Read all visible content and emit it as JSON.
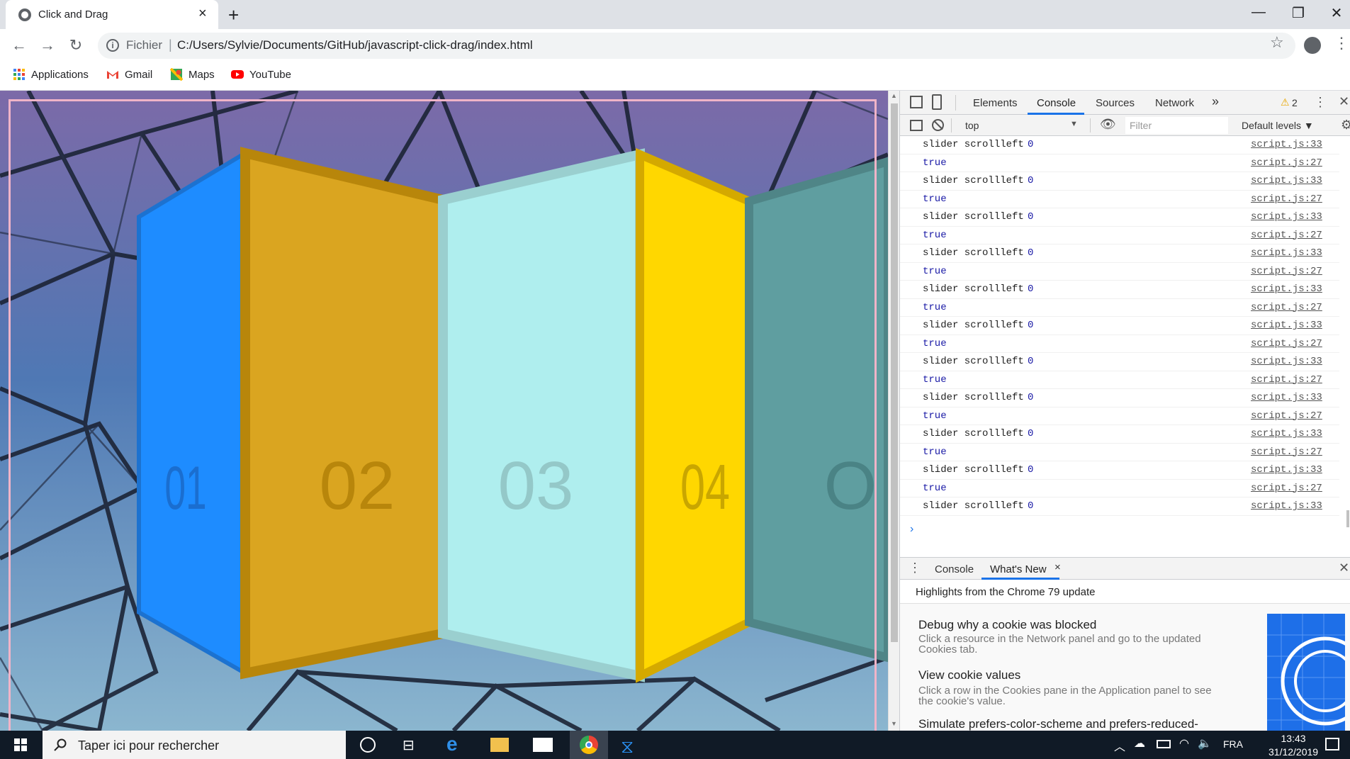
{
  "browser": {
    "tab_title": "Click and Drag",
    "tab_close": "×",
    "new_tab": "+",
    "window_minimize": "—",
    "window_restore": "❐",
    "window_close": "✕",
    "url_scheme": "Fichier",
    "url_separator": "|",
    "url": "C:/Users/Sylvie/Documents/GitHub/javascript-click-drag/index.html",
    "bookmarks": [
      {
        "label": "Applications",
        "icon": "apps-grid-icon"
      },
      {
        "label": "Gmail",
        "icon": "gmail-icon"
      },
      {
        "label": "Maps",
        "icon": "maps-icon"
      },
      {
        "label": "YouTube",
        "icon": "youtube-icon"
      }
    ]
  },
  "page": {
    "panels": [
      {
        "number": "01",
        "color": "#1e8cff"
      },
      {
        "number": "02",
        "color": "#daa520"
      },
      {
        "number": "03",
        "color": "#afeeee"
      },
      {
        "number": "04",
        "color": "#ffd700"
      },
      {
        "number": "O",
        "color": "#5f9ea0"
      }
    ]
  },
  "devtools": {
    "tabs": [
      "Elements",
      "Console",
      "Sources",
      "Network"
    ],
    "active_tab": "Console",
    "more_tabs": "»",
    "warning_count": "2",
    "context": "top",
    "filter_placeholder": "Filter",
    "levels": "Default levels ▼",
    "log_rows": [
      {
        "msg": "slider scrollleft",
        "num": "0",
        "src": "script.js:33"
      },
      {
        "msg": "true",
        "num": "",
        "src": "script.js:27"
      },
      {
        "msg": "slider scrollleft",
        "num": "0",
        "src": "script.js:33"
      },
      {
        "msg": "true",
        "num": "",
        "src": "script.js:27"
      },
      {
        "msg": "slider scrollleft",
        "num": "0",
        "src": "script.js:33"
      },
      {
        "msg": "true",
        "num": "",
        "src": "script.js:27"
      },
      {
        "msg": "slider scrollleft",
        "num": "0",
        "src": "script.js:33"
      },
      {
        "msg": "true",
        "num": "",
        "src": "script.js:27"
      },
      {
        "msg": "slider scrollleft",
        "num": "0",
        "src": "script.js:33"
      },
      {
        "msg": "true",
        "num": "",
        "src": "script.js:27"
      },
      {
        "msg": "slider scrollleft",
        "num": "0",
        "src": "script.js:33"
      },
      {
        "msg": "true",
        "num": "",
        "src": "script.js:27"
      },
      {
        "msg": "slider scrollleft",
        "num": "0",
        "src": "script.js:33"
      },
      {
        "msg": "true",
        "num": "",
        "src": "script.js:27"
      },
      {
        "msg": "slider scrollleft",
        "num": "0",
        "src": "script.js:33"
      },
      {
        "msg": "true",
        "num": "",
        "src": "script.js:27"
      },
      {
        "msg": "slider scrollleft",
        "num": "0",
        "src": "script.js:33"
      },
      {
        "msg": "true",
        "num": "",
        "src": "script.js:27"
      },
      {
        "msg": "slider scrollleft",
        "num": "0",
        "src": "script.js:33"
      },
      {
        "msg": "true",
        "num": "",
        "src": "script.js:27"
      },
      {
        "msg": "slider scrollleft",
        "num": "0",
        "src": "script.js:33"
      }
    ],
    "prompt": "›",
    "drawer_tabs": [
      "Console",
      "What's New"
    ],
    "drawer_close": "×",
    "whats_new_header": "Highlights from the Chrome 79 update",
    "whats_new_items": [
      {
        "title": "Debug why a cookie was blocked",
        "desc": "Click a resource in the Network panel and go to the updated Cookies tab."
      },
      {
        "title": "View cookie values",
        "desc": "Click a row in the Cookies pane in the Application panel to see the cookie's value."
      },
      {
        "title": "Simulate prefers-color-scheme and prefers-reduced-",
        "desc": ""
      }
    ]
  },
  "taskbar": {
    "search_placeholder": "Taper ici pour rechercher",
    "language": "FRA",
    "time": "13:43",
    "date": "31/12/2019"
  }
}
